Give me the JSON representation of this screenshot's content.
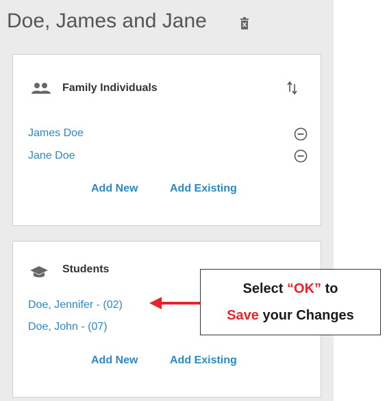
{
  "family": {
    "name": "Doe, James and Jane"
  },
  "individuals": {
    "title": "Family Individuals",
    "members": [
      "James Doe",
      "Jane Doe"
    ],
    "add_new": "Add New",
    "add_existing": "Add Existing"
  },
  "students": {
    "title": "Students",
    "members": [
      "Doe, Jennifer - (02)",
      "Doe, John - (07)"
    ],
    "add_new": "Add New",
    "add_existing": "Add Existing"
  },
  "callout": {
    "select": "Select ",
    "ok": "“OK”",
    "to": " to",
    "save": "Save",
    "rest": " your Changes"
  },
  "colors": {
    "link": "#2a89c8",
    "callout_red": "#e8242a",
    "panel_bg": "#ebebeb"
  },
  "icons": {
    "header": "trash-icon",
    "individuals": "people-icon",
    "sort": "sort-icon",
    "remove": "remove-circle-icon",
    "students": "graduation-cap-icon"
  }
}
